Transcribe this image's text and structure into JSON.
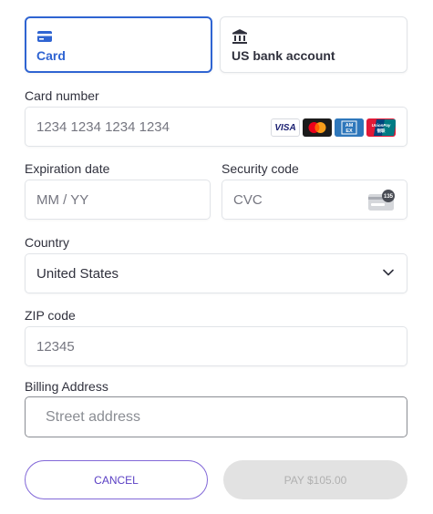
{
  "tabs": {
    "card": {
      "label": "Card",
      "icon": "credit-card-icon",
      "selected": true
    },
    "bank": {
      "label": "US bank account",
      "icon": "bank-icon",
      "selected": false
    }
  },
  "card_number": {
    "label": "Card number",
    "placeholder": "1234 1234 1234 1234",
    "brands": [
      "VISA",
      "Mastercard",
      "AMEX",
      "UnionPay"
    ]
  },
  "expiration": {
    "label": "Expiration date",
    "placeholder": "MM / YY"
  },
  "security_code": {
    "label": "Security code",
    "placeholder": "CVC",
    "icon_badge": "135"
  },
  "country": {
    "label": "Country",
    "value": "United States"
  },
  "zip": {
    "label": "ZIP code",
    "placeholder": "12345"
  },
  "billing": {
    "label": "Billing Address",
    "placeholder": "Street address"
  },
  "buttons": {
    "cancel": "CANCEL",
    "pay": "PAY $105.00"
  },
  "colors": {
    "accent": "#2f64d2",
    "cancel_border": "#8268d8",
    "pay_disabled": "#e2e2e2"
  }
}
